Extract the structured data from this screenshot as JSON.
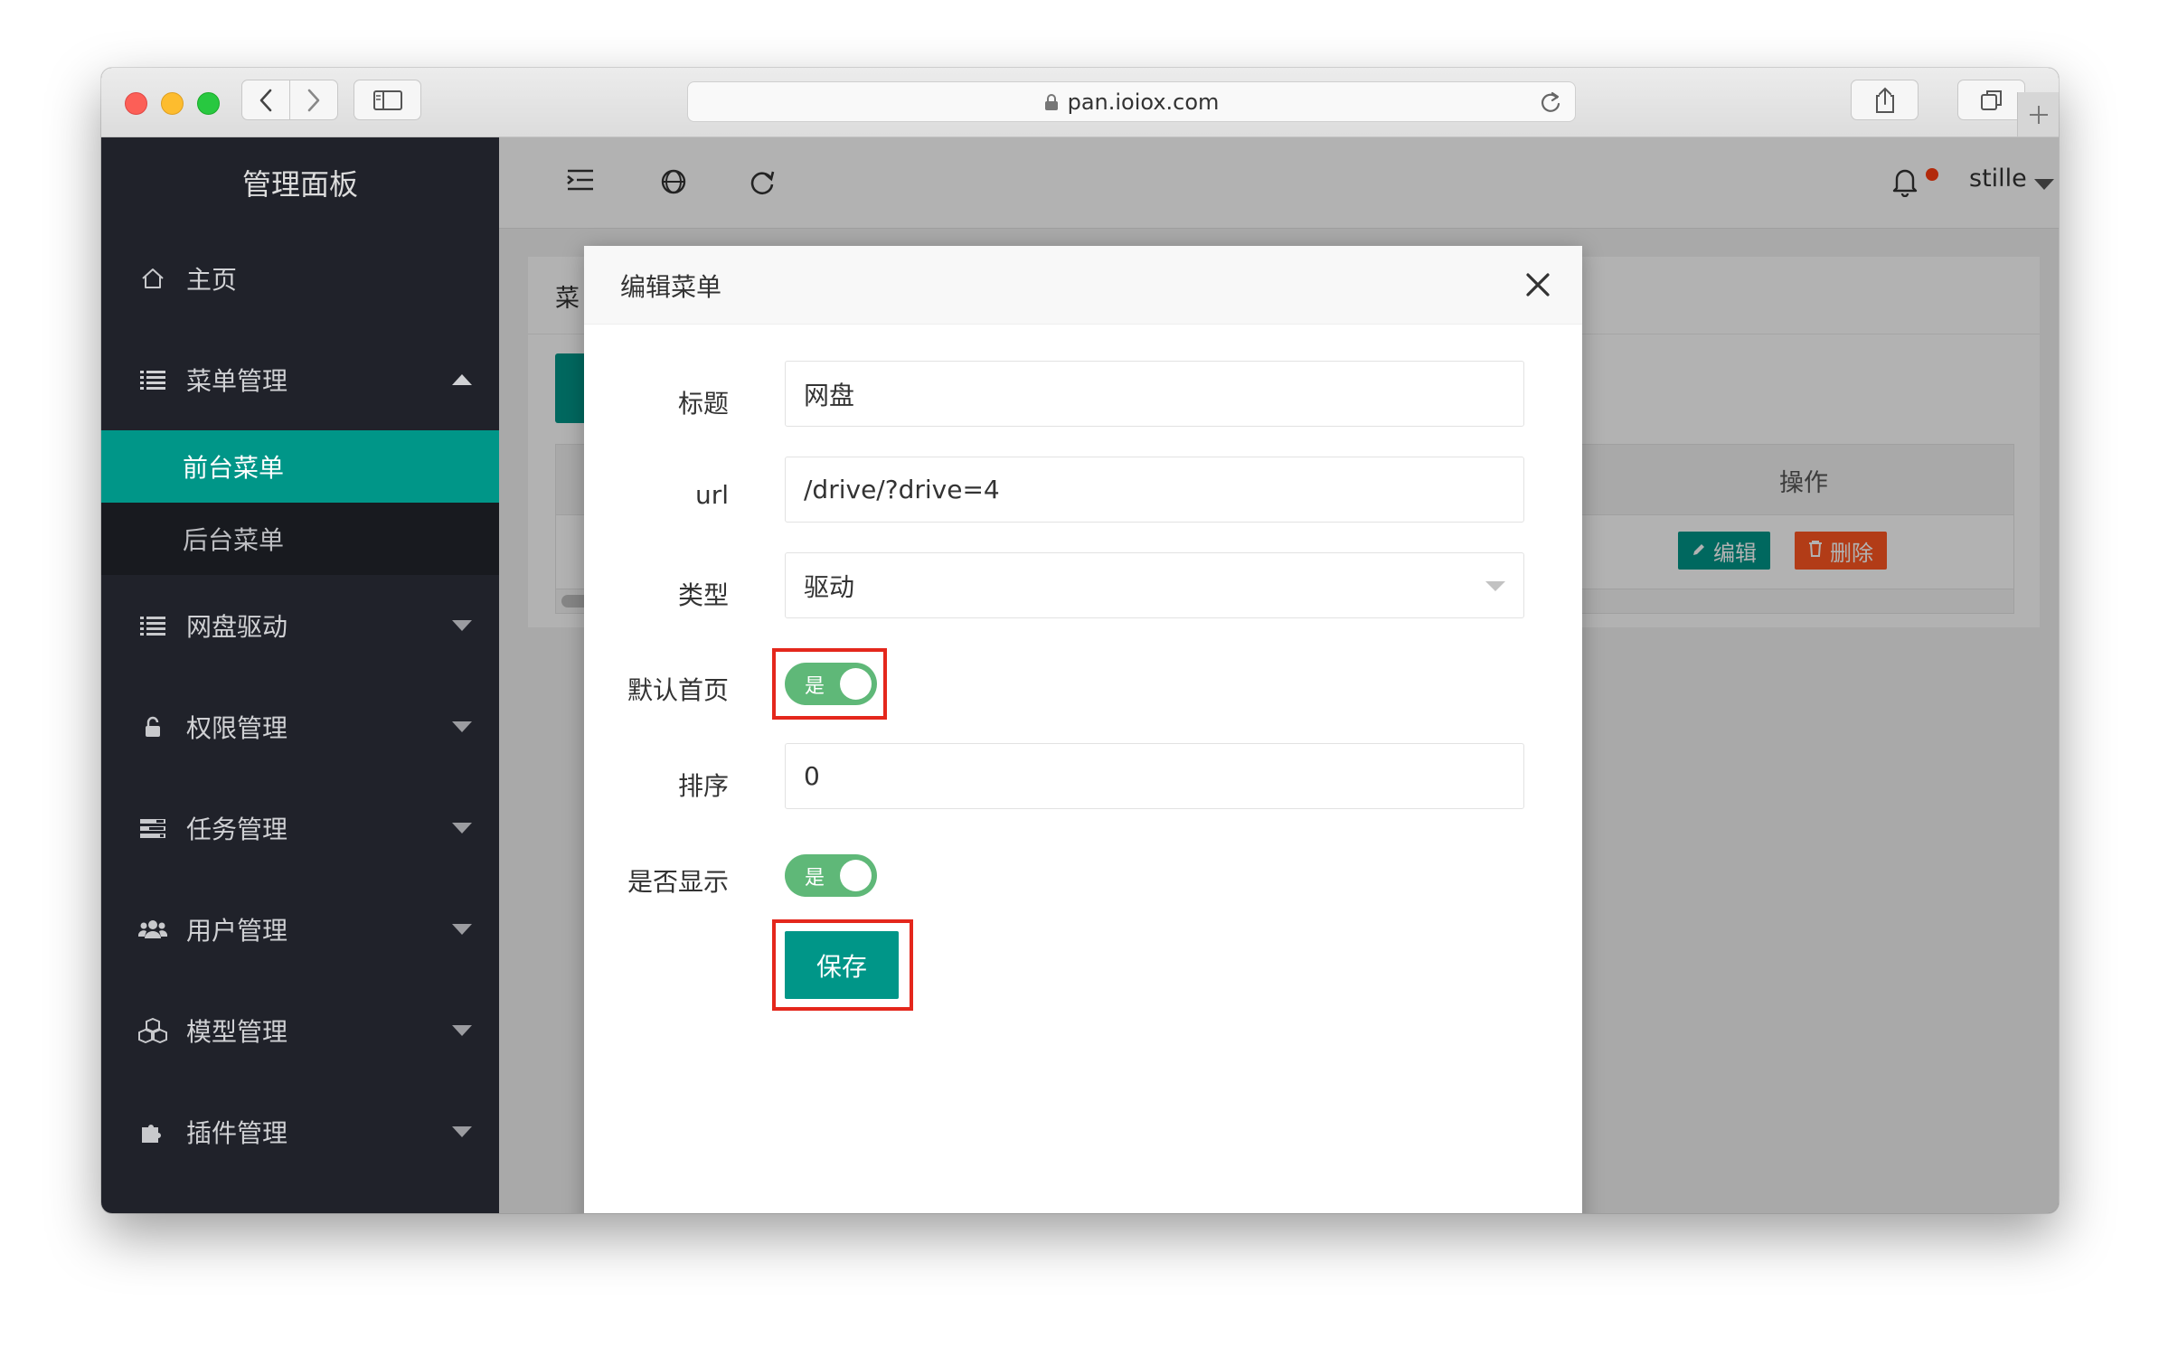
{
  "browser": {
    "url": "pan.ioiox.com"
  },
  "sidebar": {
    "title": "管理面板",
    "items": [
      {
        "label": "主页",
        "icon": "home-icon"
      },
      {
        "label": "菜单管理",
        "icon": "list-icon",
        "expanded": true,
        "children": [
          {
            "label": "前台菜单",
            "active": true
          },
          {
            "label": "后台菜单",
            "active": false
          }
        ]
      },
      {
        "label": "网盘驱动",
        "icon": "list-icon"
      },
      {
        "label": "权限管理",
        "icon": "lock-icon"
      },
      {
        "label": "任务管理",
        "icon": "tasks-icon"
      },
      {
        "label": "用户管理",
        "icon": "users-icon"
      },
      {
        "label": "模型管理",
        "icon": "cubes-icon"
      },
      {
        "label": "插件管理",
        "icon": "puzzle-icon"
      }
    ]
  },
  "header": {
    "username": "stille"
  },
  "content": {
    "card_title": "菜",
    "table": {
      "ops_header": "操作",
      "edit_label": "编辑",
      "delete_label": "删除"
    }
  },
  "modal": {
    "title": "编辑菜单",
    "fields": {
      "title_label": "标题",
      "title_value": "网盘",
      "url_label": "url",
      "url_value": "/drive/?drive=4",
      "type_label": "类型",
      "type_value": "驱动",
      "default_home_label": "默认首页",
      "default_home_value": "是",
      "sort_label": "排序",
      "sort_value": "0",
      "visible_label": "是否显示",
      "visible_value": "是"
    },
    "save_label": "保存"
  },
  "colors": {
    "accent": "#009688",
    "danger": "#ff5722",
    "switch_on": "#5fb878",
    "sidebar_bg": "#20222a",
    "highlight": "#e4271c"
  }
}
